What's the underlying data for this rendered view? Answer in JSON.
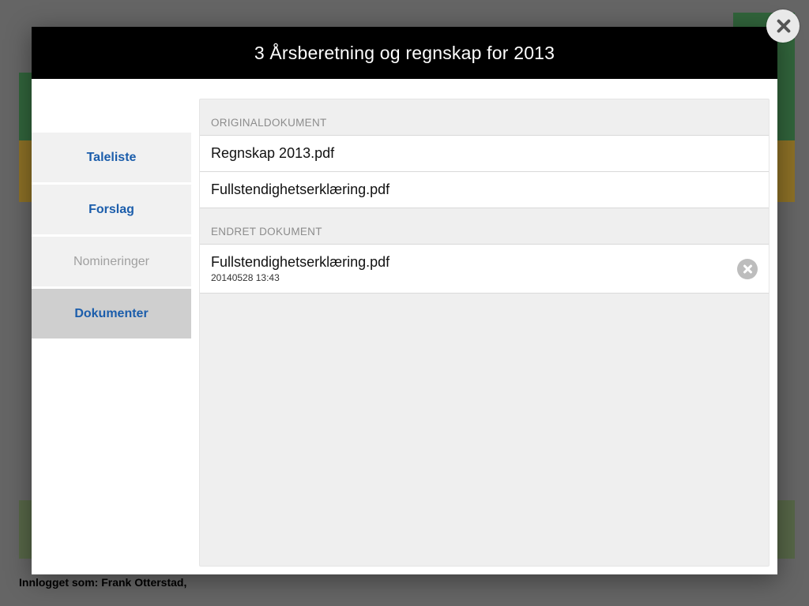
{
  "modal": {
    "title": "3 Årsberetning og regnskap for 2013"
  },
  "sidebar": {
    "tabs": [
      {
        "label": "Taleliste",
        "state": "normal"
      },
      {
        "label": "Forslag",
        "state": "normal"
      },
      {
        "label": "Nomineringer",
        "state": "disabled"
      },
      {
        "label": "Dokumenter",
        "state": "active"
      }
    ]
  },
  "sections": {
    "original": {
      "heading": "ORIGINALDOKUMENT",
      "items": [
        {
          "filename": "Regnskap 2013.pdf"
        },
        {
          "filename": "Fullstendighetserklæring.pdf"
        }
      ]
    },
    "changed": {
      "heading": "ENDRET DOKUMENT",
      "items": [
        {
          "filename": "Fullstendighetserklæring.pdf",
          "timestamp": "20140528 13:43"
        }
      ]
    }
  },
  "footer": {
    "logged_in": "Innlogget som: Frank Otterstad,"
  }
}
